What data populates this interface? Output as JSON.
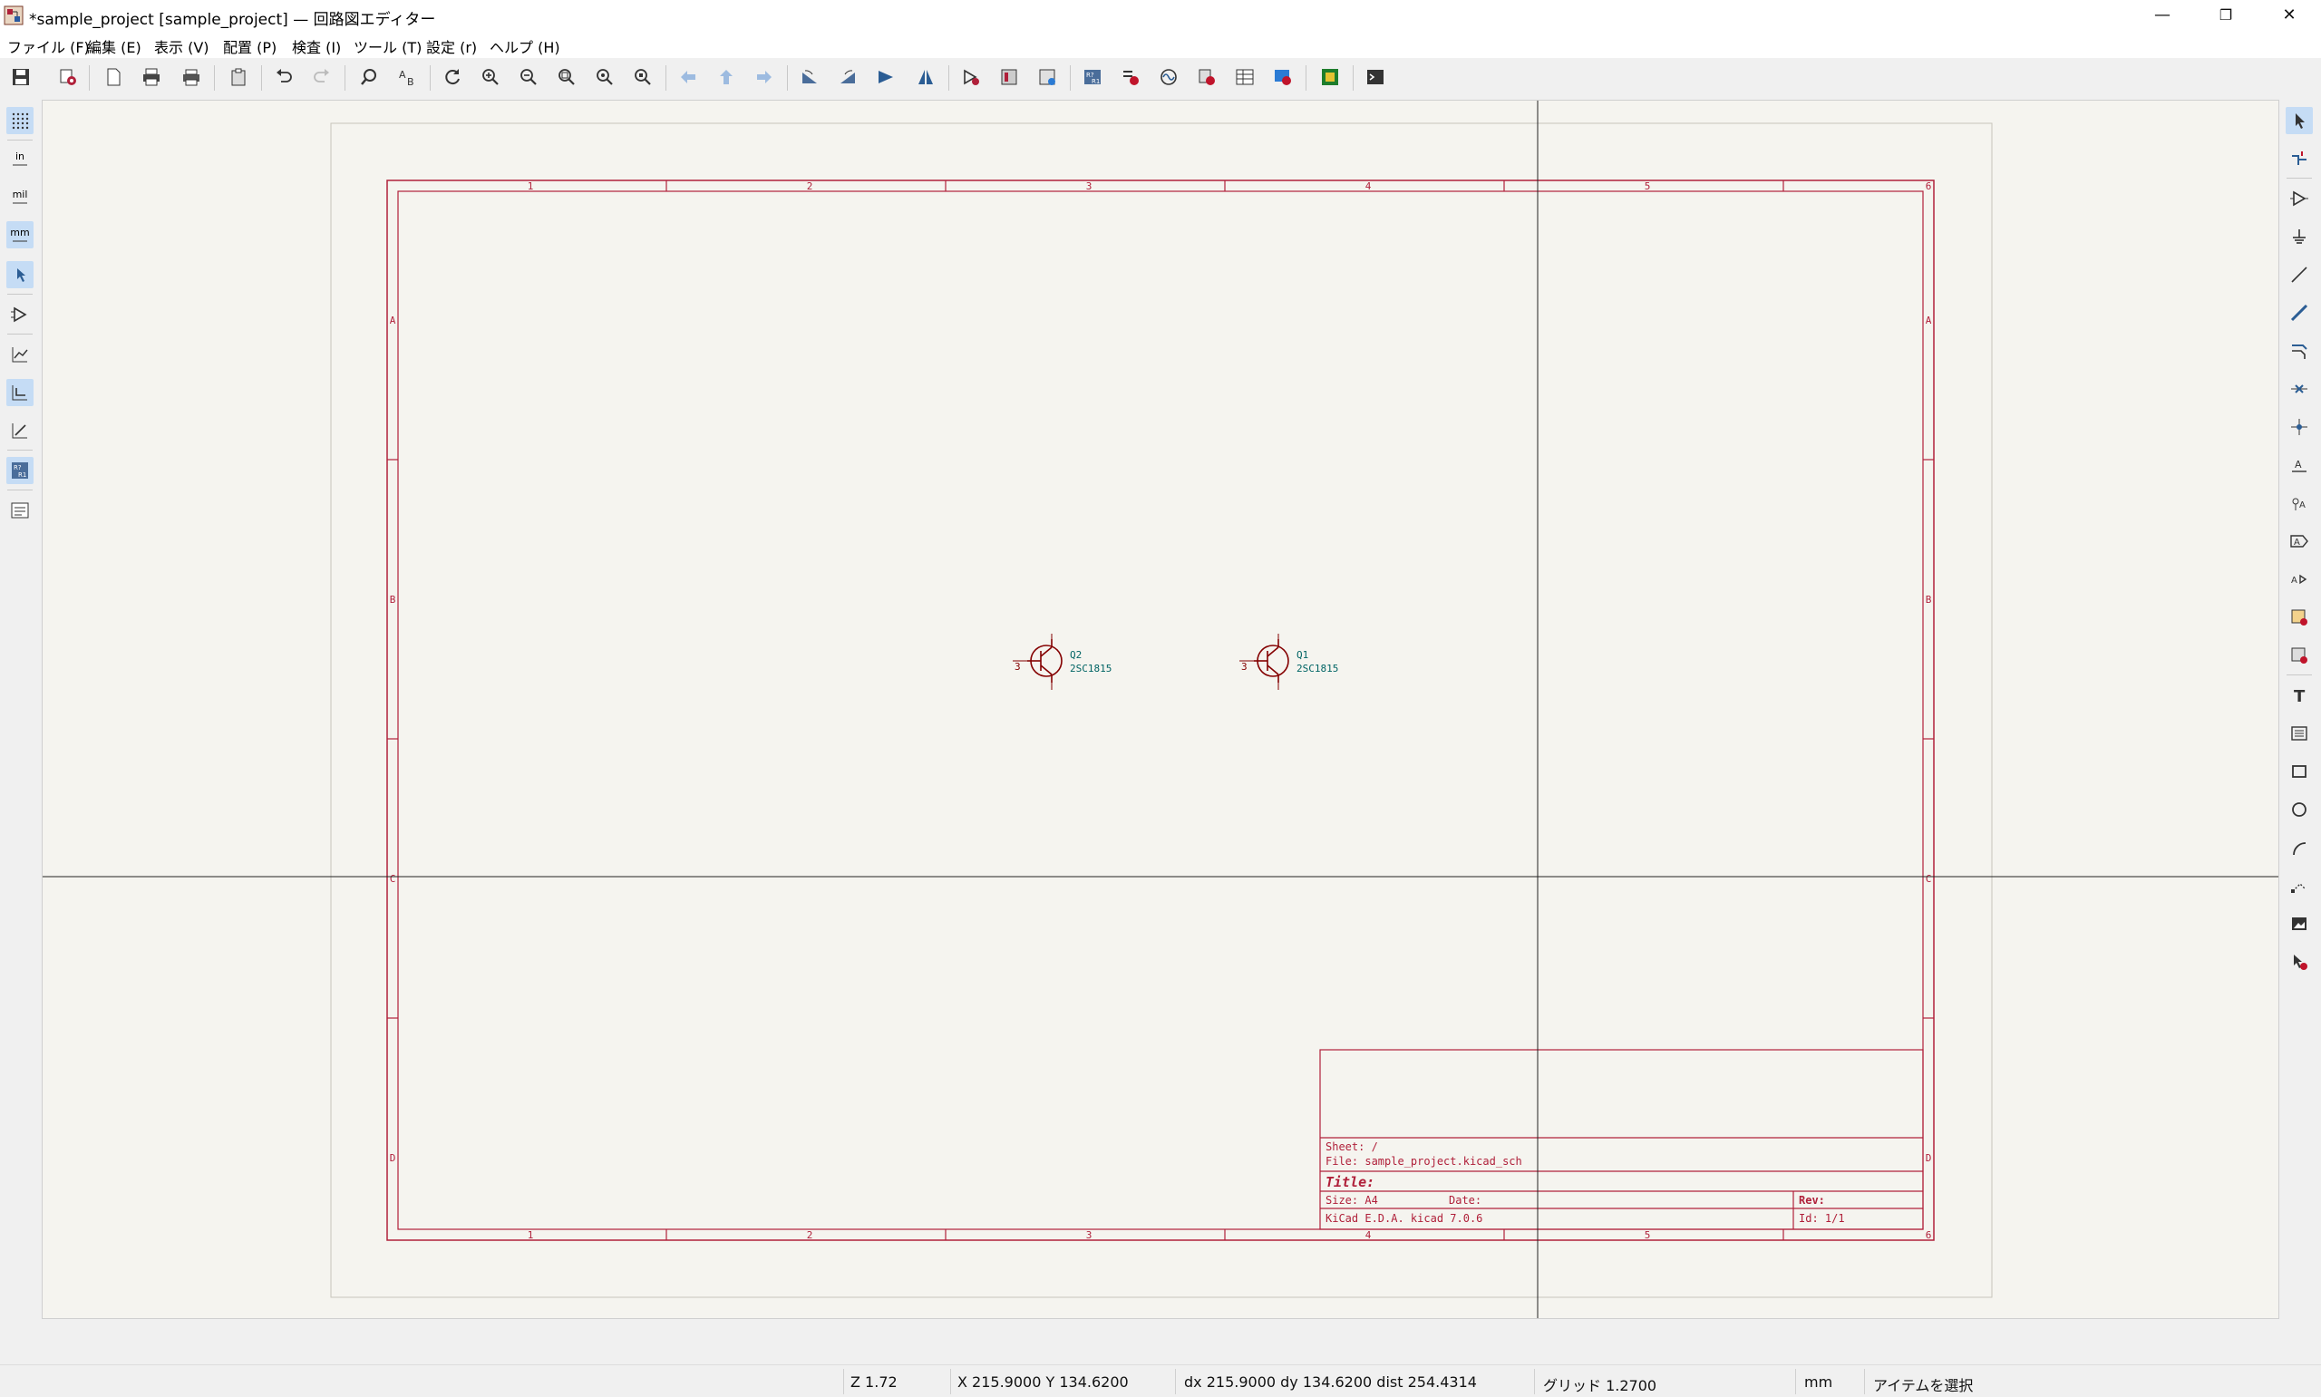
{
  "window": {
    "title": "*sample_project [sample_project] — 回路図エディター",
    "minimize": "—",
    "restore": "❐",
    "close": "✕"
  },
  "menu": [
    {
      "label": "ファイル (F)"
    },
    {
      "label": "編集 (E)"
    },
    {
      "label": "表示 (V)"
    },
    {
      "label": "配置 (P)"
    },
    {
      "label": "検査 (I)"
    },
    {
      "label": "ツール (T)"
    },
    {
      "label": "設定 (r)"
    },
    {
      "label": "ヘルプ (H)"
    }
  ],
  "toolbar": {
    "icons": [
      "save-icon",
      "schematic-setup-icon",
      "page-settings-icon",
      "print-icon",
      "plot-icon",
      "paste-icon",
      "undo-icon",
      "redo-icon",
      "find-icon",
      "find-replace-icon",
      "refresh-icon",
      "zoom-in-icon",
      "zoom-out-icon",
      "zoom-fit-icon",
      "zoom-objects-icon",
      "zoom-selection-icon",
      "nav-back-icon",
      "nav-up-icon",
      "nav-forward-icon",
      "rotate-ccw-icon",
      "rotate-cw-icon",
      "mirror-v-icon",
      "mirror-h-icon",
      "symbol-editor-icon",
      "symbol-browser-icon",
      "footprint-assign-icon",
      "annotate-icon",
      "erc-icon",
      "simulator-icon",
      "bom-icon",
      "field-editor-icon",
      "update-pcb-icon",
      "pcb-editor-icon",
      "scripting-console-icon"
    ]
  },
  "left_toolbar": {
    "icons": [
      "grid-toggle-icon",
      "inches-icon",
      "mils-icon",
      "millimeters-icon",
      "cursor-full-icon",
      "hidden-pins-icon",
      "line-mode-free-icon",
      "line-mode-90-icon",
      "line-mode-45-icon",
      "annotate-toggle-icon",
      "hierarchy-navigator-icon"
    ],
    "labels": {
      "in": "in",
      "mil": "mil",
      "mm": "mm"
    }
  },
  "right_toolbar": {
    "icons": [
      "select-icon",
      "highlight-net-icon",
      "add-symbol-icon",
      "add-power-icon",
      "add-wire-icon",
      "add-bus-icon",
      "add-bus-entry-icon",
      "no-connect-icon",
      "add-junction-icon",
      "add-label-icon",
      "add-net-class-directive-icon",
      "add-global-label-icon",
      "add-hier-label-icon",
      "add-sheet-icon",
      "import-sheet-pin-icon",
      "add-text-icon",
      "add-textbox-icon",
      "add-rectangle-icon",
      "add-circle-icon",
      "add-arc-icon",
      "add-graphic-line-icon",
      "add-image-icon",
      "delete-icon"
    ]
  },
  "schematic": {
    "col_labels": [
      "1",
      "2",
      "3",
      "4",
      "5",
      "6"
    ],
    "row_labels": [
      "A",
      "B",
      "C",
      "D"
    ],
    "title_block": {
      "sheet": "Sheet: /",
      "file": "File: sample_project.kicad_sch",
      "title": "Title:",
      "size": "Size: A4",
      "date": "Date:",
      "rev": "Rev:",
      "tool": "KiCad E.D.A.  kicad 7.0.6",
      "id": "Id: 1/1"
    },
    "symbols": [
      {
        "ref": "Q2",
        "value": "2SC1815",
        "pin": "3"
      },
      {
        "ref": "Q1",
        "value": "2SC1815",
        "pin": "3"
      }
    ],
    "colors": {
      "frame": "#b0203a",
      "symbol": "#840000",
      "field": "#006464",
      "background": "#f5f4ef"
    }
  },
  "status": {
    "zoom": "Z 1.72",
    "xy": "X 215.9000  Y 134.6200",
    "dxdy": "dx 215.9000  dy 134.6200  dist 254.4314",
    "grid": "グリッド 1.2700",
    "units": "mm",
    "mode": "アイテムを選択"
  }
}
